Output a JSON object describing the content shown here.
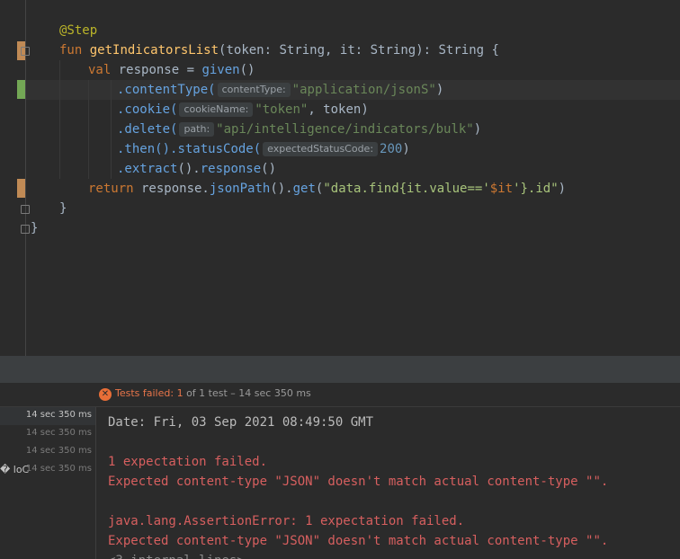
{
  "editor": {
    "annotation": "@Step",
    "fun_kw": "fun",
    "fn_name": "getIndicatorsList",
    "params_open": "(token: ",
    "type_string": "String",
    "params_mid": ", it: ",
    "params_close": "): ",
    "brace_open": " {",
    "val_kw": "val",
    "response_decl": " response = ",
    "given_call": "given",
    "given_parens": "()",
    "content_type_call": ".contentType(",
    "content_type_hint": "contentType:",
    "content_type_value": "\"application/jsonS\"",
    "cookie_call": ".cookie(",
    "cookie_hint": "cookieName:",
    "cookie_value": "\"token\"",
    "cookie_sep": ", token)",
    "delete_call": ".delete(",
    "delete_hint": "path:",
    "delete_value": "\"api/intelligence/indicators/bulk\"",
    "then_call": ".then",
    "status_code_call": "().statusCode(",
    "status_code_hint": "expectedStatusCode:",
    "status_code_value": "200",
    "extract_call": ".extract",
    "extract_mid": "().",
    "response_call": "response",
    "return_kw": "return",
    "return_mid": " response.",
    "json_path_call": "jsonPath",
    "json_path_mid": "().",
    "get_call": "get",
    "get_open": "(",
    "find_str_start": "\"data.find{it.value=='",
    "find_template": "$it",
    "find_str_end": "'}.id\"",
    "close_paren": ")",
    "inner_close_brace": "}",
    "outer_close_brace": "}"
  },
  "status": {
    "icon": "error-circle-icon",
    "failed_label": "Tests failed: 1",
    "summary": " of 1 test – 14 sec 350 ms"
  },
  "tree": {
    "times": [
      "14 sec 350 ms",
      "14 sec 350 ms",
      "14 sec 350 ms",
      "14 sec 350 ms"
    ],
    "partial_label": "� loC"
  },
  "console": {
    "lines": [
      "Date: Fri, 03 Sep 2021 08:49:50 GMT",
      "1 expectation failed.",
      "Expected content-type \"JSON\" doesn't match actual content-type \"\".",
      "java.lang.AssertionError: 1 expectation failed.",
      "Expected content-type \"JSON\" doesn't match actual content-type \"\".",
      "<3 internal lines>"
    ]
  }
}
